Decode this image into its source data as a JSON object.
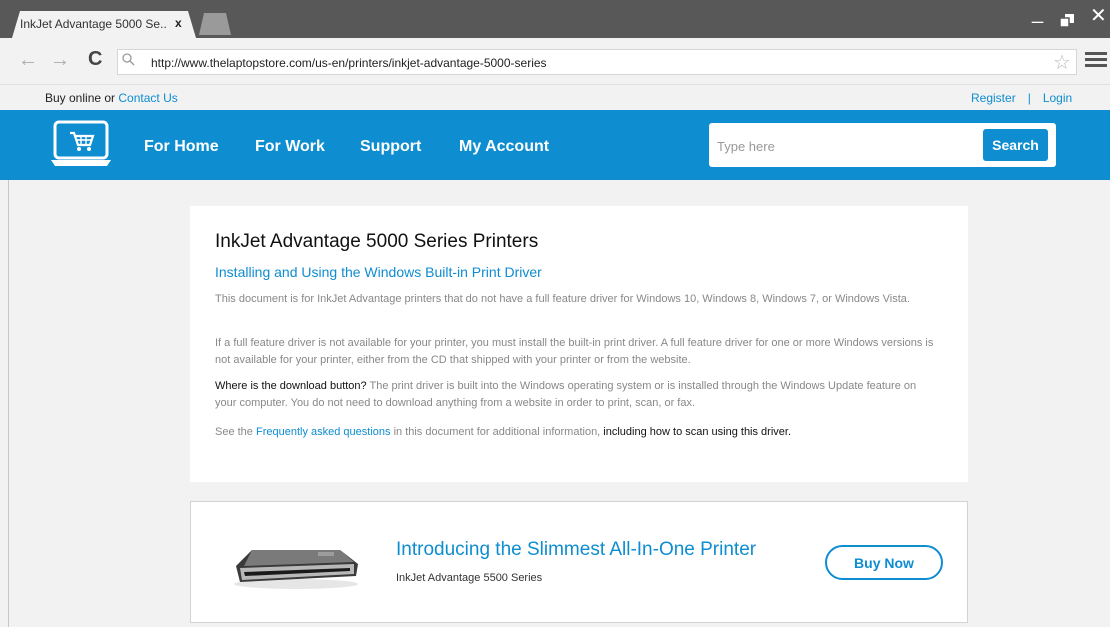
{
  "browser": {
    "tab_title": "InkJet Advantage 5000 Se..",
    "tab_close": "x",
    "url": "http://www.thelaptopstore.com/us-en/printers/inkjet-advantage-5000-series"
  },
  "topbar": {
    "left_text": "Buy online or ",
    "contact_link": "Contact Us",
    "register": "Register",
    "separator": "|",
    "login": "Login"
  },
  "header": {
    "nav": [
      "For Home",
      "For Work",
      "Support",
      "My Account"
    ],
    "search_placeholder": "Type here",
    "search_button": "Search",
    "accent": "#0e8dd0"
  },
  "article": {
    "title": "InkJet Advantage 5000 Series Printers",
    "subtitle": "Installing and Using the Windows Built-in Print Driver",
    "p1": "This document is for InkJet Advantage printers that do not have a full feature driver for Windows 10, Windows 8, Windows 7, or Windows Vista.",
    "p2": "If a full feature driver is not available for your printer, you must install the built-in print driver. A full feature driver for one or more Windows versions is not available for your printer, either from the CD that shipped with your printer or from the website.",
    "p3_lead": "Where is the download button?",
    "p3_rest": " The print driver is built into the Windows operating system or is installed through the Windows Update feature on your computer. You do not need to download anything from a website in order to print, scan, or fax.",
    "p4_pre": "See the ",
    "p4_link": "Frequently asked questions",
    "p4_mid": " in this document for additional information, ",
    "p4_dark": "including how to scan using this driver."
  },
  "promo": {
    "title": "Introducing the Slimmest All-In-One Printer",
    "subtitle": "InkJet Advantage 5500 Series",
    "button": "Buy Now"
  }
}
